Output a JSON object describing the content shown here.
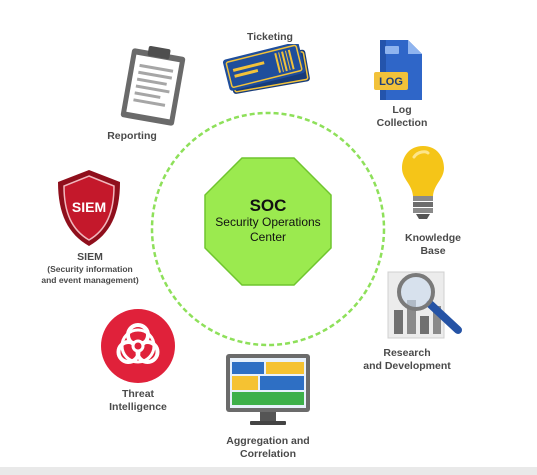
{
  "center": {
    "title": "SOC",
    "subtitle_lines": [
      "Security Operations",
      "Center"
    ]
  },
  "nodes": {
    "ticketing": {
      "label": "Ticketing",
      "icon": "ticket-icon"
    },
    "log_collection": {
      "label_lines": [
        "Log",
        "Collection"
      ],
      "icon": "log-file-icon",
      "badge": "LOG"
    },
    "knowledge_base": {
      "label_lines": [
        "Knowledge",
        "Base"
      ],
      "icon": "lightbulb-icon"
    },
    "research": {
      "label_lines": [
        "Research",
        "and Development"
      ],
      "icon": "magnifier-chart-icon"
    },
    "aggregation": {
      "label_lines": [
        "Aggregation and",
        "Correlation"
      ],
      "icon": "monitor-icon"
    },
    "threat_intel": {
      "label_lines": [
        "Threat",
        "Intelligence"
      ],
      "icon": "biohazard-icon"
    },
    "siem": {
      "label_lines": [
        "SIEM",
        "(Security information",
        "and event management)"
      ],
      "icon": "siem-shield-icon",
      "badge": "SIEM"
    },
    "reporting": {
      "label": "Reporting",
      "icon": "clipboard-icon"
    }
  },
  "colors": {
    "octagon": "#9bea4f",
    "ring": "#8ee05a",
    "siem_red": "#c4182b",
    "threat_red": "#e0213a",
    "ticket_blue": "#1f4e9c",
    "ticket_gold": "#f2c23a",
    "bulb": "#f5c518",
    "monitor_blue": "#2e6fc4",
    "monitor_yellow": "#f5c232",
    "monitor_green": "#3db04a"
  }
}
